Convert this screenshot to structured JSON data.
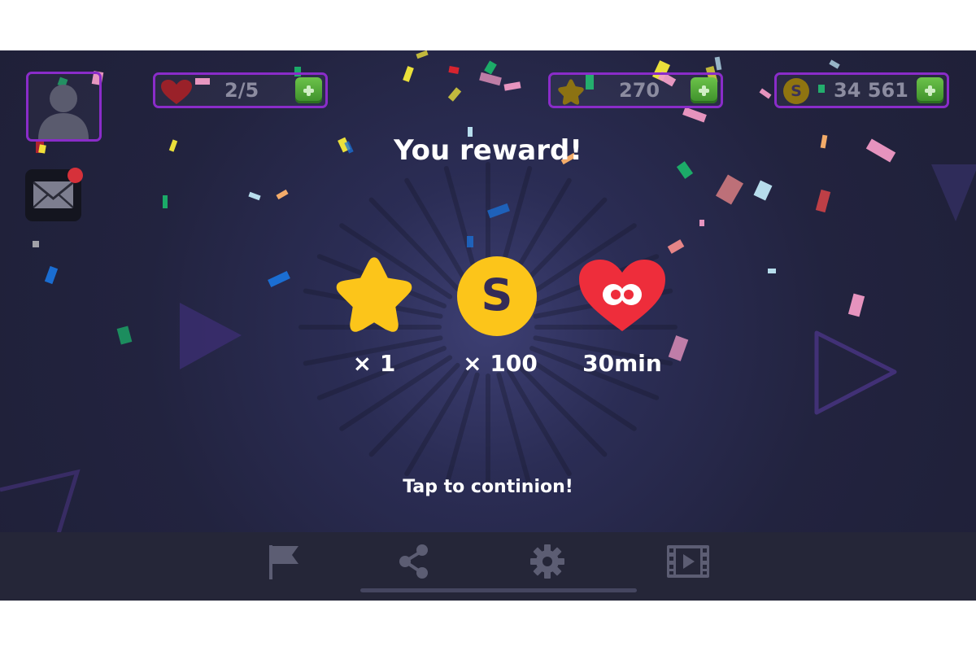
{
  "hud": {
    "lives": "2/5",
    "stars": "270",
    "coins": "34 561",
    "coin_symbol": "S"
  },
  "title": "You reward!",
  "rewards": [
    {
      "icon": "star-icon",
      "label": "× 1"
    },
    {
      "icon": "coin-icon",
      "symbol": "S",
      "label": "× 100"
    },
    {
      "icon": "infinite-heart-icon",
      "label": "30min"
    }
  ],
  "prompt": "Tap to continion!",
  "nav": [
    {
      "icon": "flag-icon"
    },
    {
      "icon": "share-icon"
    },
    {
      "icon": "gear-icon"
    },
    {
      "icon": "video-icon"
    }
  ],
  "colors": {
    "background": "#23243f",
    "pill_border": "#8a2cc9",
    "plus_button": "#4fa535",
    "gold": "#fcc51a",
    "heart_red": "#ee2d3b",
    "bottom_bar": "#252638"
  }
}
